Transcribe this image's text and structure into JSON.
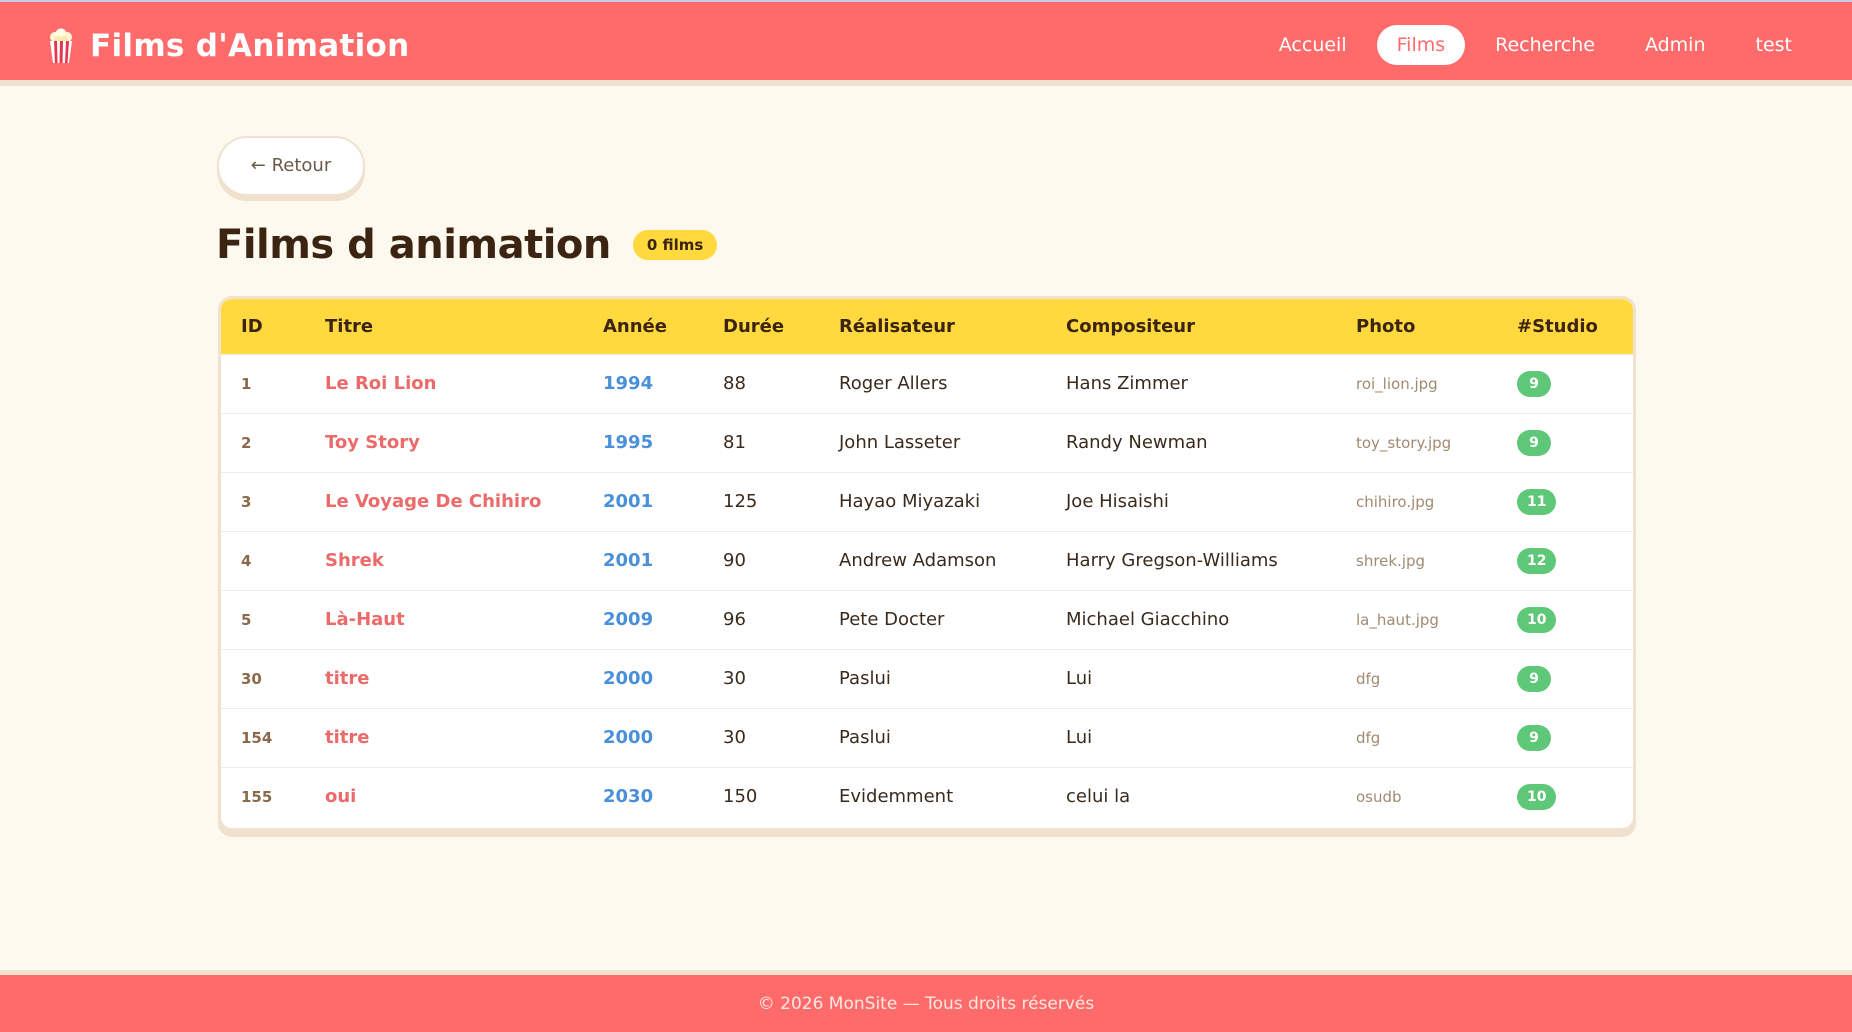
{
  "brand": {
    "title": "Films d'Animation",
    "icon": "popcorn-icon"
  },
  "nav": {
    "items": [
      {
        "label": "Accueil",
        "active": false
      },
      {
        "label": "Films",
        "active": true
      },
      {
        "label": "Recherche",
        "active": false
      },
      {
        "label": "Admin",
        "active": false
      },
      {
        "label": "test",
        "active": false
      }
    ]
  },
  "back_label": "← Retour",
  "page": {
    "title": "Films d animation",
    "count_badge": "0 films"
  },
  "table": {
    "columns": [
      "ID",
      "Titre",
      "Année",
      "Durée",
      "Réalisateur",
      "Compositeur",
      "Photo",
      "#Studio"
    ],
    "rows": [
      {
        "id": "1",
        "titre": "Le Roi Lion",
        "annee": "1994",
        "duree": "88",
        "realisateur": "Roger Allers",
        "compositeur": "Hans Zimmer",
        "photo": "roi_lion.jpg",
        "studio": "9"
      },
      {
        "id": "2",
        "titre": "Toy Story",
        "annee": "1995",
        "duree": "81",
        "realisateur": "John Lasseter",
        "compositeur": "Randy Newman",
        "photo": "toy_story.jpg",
        "studio": "9"
      },
      {
        "id": "3",
        "titre": "Le Voyage De Chihiro",
        "annee": "2001",
        "duree": "125",
        "realisateur": "Hayao Miyazaki",
        "compositeur": "Joe Hisaishi",
        "photo": "chihiro.jpg",
        "studio": "11"
      },
      {
        "id": "4",
        "titre": "Shrek",
        "annee": "2001",
        "duree": "90",
        "realisateur": "Andrew Adamson",
        "compositeur": "Harry Gregson-Williams",
        "photo": "shrek.jpg",
        "studio": "12"
      },
      {
        "id": "5",
        "titre": "Là-Haut",
        "annee": "2009",
        "duree": "96",
        "realisateur": "Pete Docter",
        "compositeur": "Michael Giacchino",
        "photo": "la_haut.jpg",
        "studio": "10"
      },
      {
        "id": "30",
        "titre": "titre",
        "annee": "2000",
        "duree": "30",
        "realisateur": "Paslui",
        "compositeur": "Lui",
        "photo": "dfg",
        "studio": "9"
      },
      {
        "id": "154",
        "titre": "titre",
        "annee": "2000",
        "duree": "30",
        "realisateur": "Paslui",
        "compositeur": "Lui",
        "photo": "dfg",
        "studio": "9"
      },
      {
        "id": "155",
        "titre": "oui",
        "annee": "2030",
        "duree": "150",
        "realisateur": "Evidemment",
        "compositeur": "celui la",
        "photo": "osudb",
        "studio": "10"
      }
    ]
  },
  "footer": {
    "text": "© 2026 MonSite — Tous droits réservés"
  },
  "colors": {
    "header_bg": "#ff6b6b",
    "page_bg": "#fef9ee",
    "table_header_bg": "#ffd93d",
    "title_link": "#ec6a6a",
    "year_link": "#4a90d9",
    "studio_badge": "#5fc778"
  }
}
